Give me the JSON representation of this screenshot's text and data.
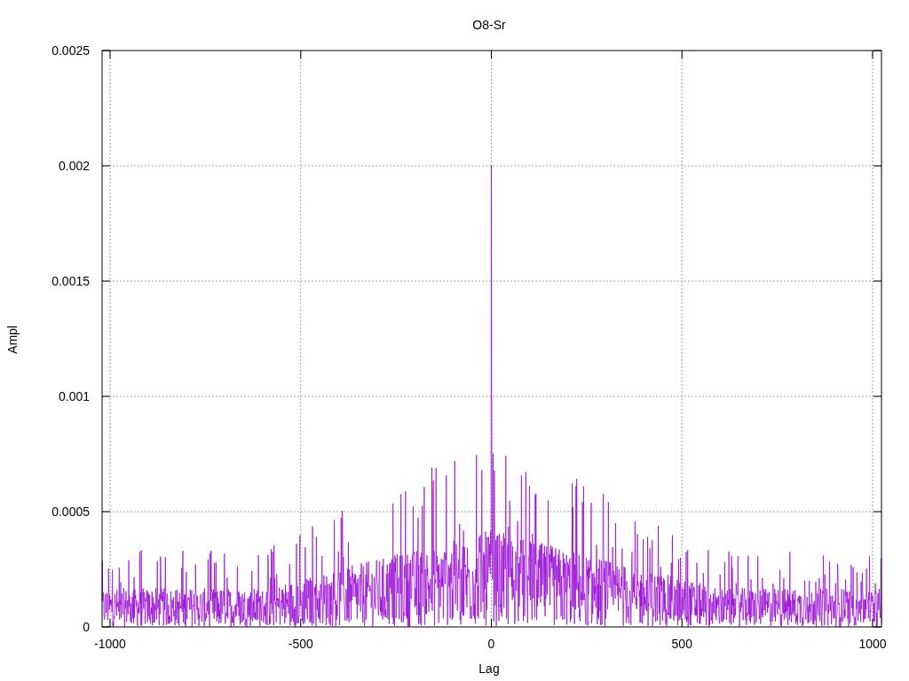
{
  "plot": {
    "title": "O8-Sr",
    "xlabel": "Lag",
    "ylabel": "Ampl",
    "xticks": [
      "-1000",
      "-500",
      "0",
      "500",
      "1000"
    ],
    "yticks": [
      "0.0025",
      "0.002",
      "0.0015",
      "0.001",
      "0.0005",
      "0"
    ]
  }
}
